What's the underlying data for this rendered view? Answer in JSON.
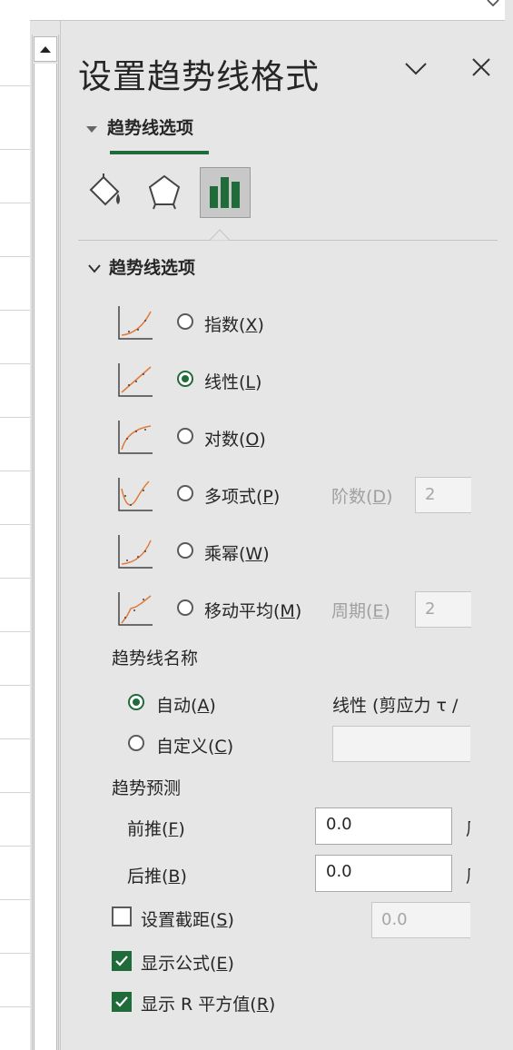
{
  "pane": {
    "title": "设置趋势线格式",
    "tab_label": "趋势线选项",
    "section_label": "趋势线选项"
  },
  "icons": [
    "fill-line-icon",
    "effects-pentagon-icon",
    "trendline-options-bar-icon",
    "chevron-down-icon",
    "close-icon",
    "scroll-up-arrow-icon"
  ],
  "colors": {
    "accent": "#1f6b3a",
    "panel": "#e6e6e6",
    "trend": "#e07a3a"
  },
  "trend_types": [
    {
      "label": "指数(",
      "key": "X",
      "selected": false
    },
    {
      "label": "线性(",
      "key": "L",
      "selected": true
    },
    {
      "label": "对数(",
      "key": "O",
      "selected": false
    },
    {
      "label": "多项式(",
      "key": "P",
      "selected": false
    },
    {
      "label": "乘幂(",
      "key": "W",
      "selected": false
    },
    {
      "label": "移动平均(",
      "key": "M",
      "selected": false
    }
  ],
  "order": {
    "label": "阶数(",
    "key": "D",
    "value": "2"
  },
  "period": {
    "label": "周期(",
    "key": "E",
    "value": "2"
  },
  "name": {
    "heading": "趋势线名称",
    "auto_label": "自动(",
    "auto_key": "A",
    "auto_value": "线性 (剪应力 τ /",
    "custom_label": "自定义(",
    "custom_key": "C",
    "custom_value": ""
  },
  "forecast": {
    "heading": "趋势预测",
    "forward_label": "前推(",
    "forward_key": "F",
    "forward_value": "0.0",
    "backward_label": "后推(",
    "backward_key": "B",
    "backward_value": "0.0",
    "unit": "周"
  },
  "intercept": {
    "label": "设置截距(",
    "key": "S",
    "value": "0.0",
    "checked": false
  },
  "show_equation": {
    "label": "显示公式(",
    "key": "E",
    "checked": true
  },
  "show_r2": {
    "label": "显示 R 平方值(",
    "key": "R",
    "checked": true
  }
}
